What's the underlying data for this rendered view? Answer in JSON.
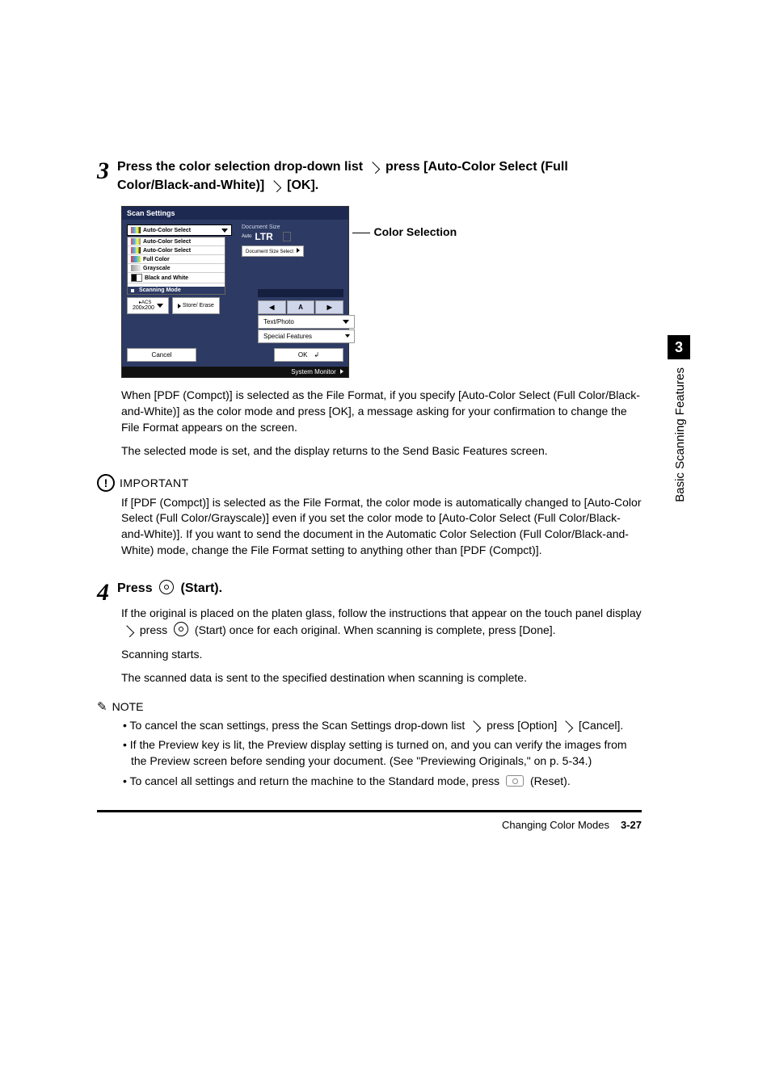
{
  "sidebar": {
    "chapter_number": "3",
    "chapter_title": "Basic Scanning Features"
  },
  "step3": {
    "number": "3",
    "heading_1": "Press the color selection drop-down list",
    "heading_2": "press [Auto-Color Select (Full Color/Black-and-White)]",
    "heading_3": "[OK].",
    "callout": "Color Selection",
    "para1": "When [PDF (Compct)] is selected as the File Format, if you specify [Auto-Color Select (Full Color/Black-and-White)] as the color mode and press [OK], a message asking for your confirmation to change the File Format appears on the screen.",
    "para2": "The selected mode is set, and the display returns to the Send Basic Features screen.",
    "important_label": "IMPORTANT",
    "important_body": "If [PDF (Compct)] is selected as the File Format, the color mode is automatically changed to [Auto-Color Select (Full Color/Grayscale)] even if you set the color mode to [Auto-Color Select (Full Color/Black-and-White)]. If you want to send the document in the Automatic Color Selection (Full Color/Black-and-White) mode, change the File Format setting to anything other than [PDF (Compct)]."
  },
  "screenshot": {
    "title": "Scan Settings",
    "dropdown_selected": "Auto-Color Select",
    "options": [
      "Auto-Color Select",
      "Auto-Color Select",
      "Full Color",
      "Grayscale",
      "Black and White"
    ],
    "scanning_mode_label": "Scanning Mode",
    "acs_label": "ACS",
    "acs_res": "200x200",
    "store_erase": "Store/ Erase",
    "doc_size_label": "Document Size",
    "paper": "LTR",
    "auto_chip": "Auto",
    "doc_size_select": "Document Size Select",
    "nav": {
      "left": "◀",
      "mid": "A",
      "right": "▶"
    },
    "text_photo": "Text/Photo",
    "special": "Special Features",
    "cancel": "Cancel",
    "ok": "OK",
    "system_monitor": "System Monitor"
  },
  "step4": {
    "number": "4",
    "heading_pre": "Press",
    "heading_post": "(Start).",
    "para1_a": "If the original is placed on the platen glass, follow the instructions that appear on the touch panel display",
    "para1_b": "press",
    "para1_c": "(Start) once for each original. When scanning is complete, press [Done].",
    "para2": "Scanning starts.",
    "para3": "The scanned data is sent to the specified destination when scanning is complete.",
    "note_label": "NOTE",
    "notes": {
      "n1_a": "To cancel the scan settings, press the Scan Settings drop-down list",
      "n1_b": "press [Option]",
      "n1_c": "[Cancel].",
      "n2": "If the Preview key is lit, the Preview display setting is turned on, and you can verify the images from the Preview screen before sending your document. (See \"Previewing Originals,\" on p. 5-34.)",
      "n3_a": "To cancel all settings and return the machine to the Standard mode, press",
      "n3_b": "(Reset)."
    }
  },
  "footer": {
    "section": "Changing Color Modes",
    "page": "3-27"
  }
}
